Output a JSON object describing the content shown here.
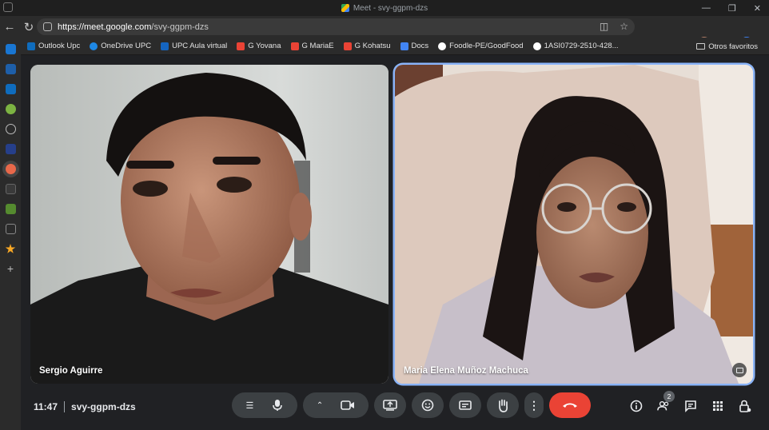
{
  "browser": {
    "window_title": "Meet - svy-ggpm-dzs",
    "url_host": "https://meet.google.com",
    "url_path": "/svy-ggpm-dzs",
    "bookmarks": [
      {
        "label": "Outlook Upc",
        "color": "#0f6cbd"
      },
      {
        "label": "OneDrive UPC",
        "color": "#1e88e5"
      },
      {
        "label": "UPC Aula virtual",
        "color": "#1565c0"
      },
      {
        "label": "G Yovana",
        "color": "#ea4335"
      },
      {
        "label": "G MariaE",
        "color": "#ea4335"
      },
      {
        "label": "G Kohatsu",
        "color": "#ea4335"
      },
      {
        "label": "Docs",
        "color": "#4285f4"
      },
      {
        "label": "Foodle-PE/GoodFood",
        "color": "#ffffff"
      },
      {
        "label": "1ASI0729-2510-428...",
        "color": "#ffffff"
      }
    ],
    "other_favorites": "Otros favoritos"
  },
  "meet": {
    "participants": [
      {
        "name": "Sergio Aguirre"
      },
      {
        "name": "Maria Elena Muñoz Machuca"
      }
    ],
    "time": "11:47",
    "meeting_code": "svy-ggpm-dzs",
    "people_count": "2",
    "accent": "#8ab4f8",
    "hangup_color": "#ea4335"
  }
}
